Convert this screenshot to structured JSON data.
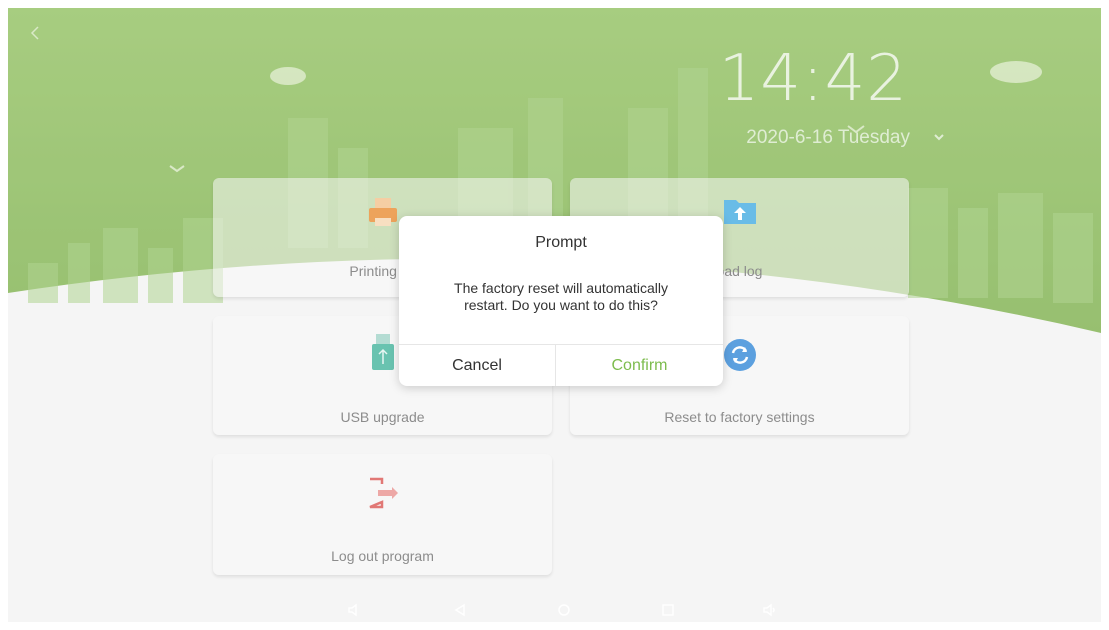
{
  "status": {
    "back_icon": "chevron-left-icon",
    "time": "14:42",
    "date": "2020-6-16 Tuesday",
    "date_dropdown_icon": "chevron-down-icon"
  },
  "colors": {
    "header_green": "#7fb24f",
    "accent_green": "#7dbc4e",
    "dialog_bg": "#ffffff"
  },
  "tiles": [
    {
      "id": "printing",
      "label": "Printing se",
      "icon": "printer-icon"
    },
    {
      "id": "upload-log",
      "label": "oad log",
      "icon": "folder-upload-icon"
    },
    {
      "id": "usb-upgrade",
      "label": "USB upgrade",
      "icon": "usb-drive-icon"
    },
    {
      "id": "factory-reset",
      "label": "Reset to factory settings",
      "icon": "refresh-icon"
    },
    {
      "id": "logout",
      "label": "Log out program",
      "icon": "logout-icon"
    }
  ],
  "dialog": {
    "title": "Prompt",
    "message_line1": "The factory reset will automatically",
    "message_line2": "restart. Do you want to do this?",
    "cancel_label": "Cancel",
    "confirm_label": "Confirm"
  },
  "navbar": {
    "buttons": [
      "volume-down-icon",
      "back-triangle-icon",
      "home-circle-icon",
      "recents-square-icon",
      "volume-up-icon"
    ]
  }
}
